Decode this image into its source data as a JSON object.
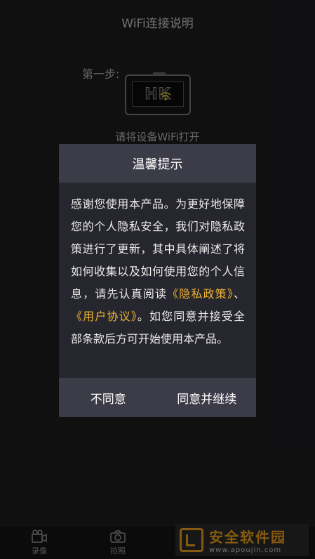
{
  "header": {
    "title": "WiFi连接说明"
  },
  "guide": {
    "step_label": "第一步:",
    "device_logo": "HK",
    "instruction": "请将设备WiFi打开"
  },
  "bottom_nav": {
    "items": [
      {
        "label": "录像",
        "icon": "video-camera-icon"
      },
      {
        "label": "拍照",
        "icon": "photo-camera-icon"
      }
    ]
  },
  "watermark": {
    "title": "安全软件园",
    "url": "www.apoujin.com"
  },
  "dialog": {
    "title": "温馨提示",
    "body_before": "感谢您使用本产品。为更好地保障您的个人隐私安全，我们对隐私政策进行了更新，其中具体阐述了将如何收集以及如何使用您的个人信息，请先认真阅读",
    "privacy_link": "《隐私政策》",
    "separator": "、",
    "terms_link": "《用户协议》",
    "body_after": "。如您同意并接受全部条款后方可开始使用本产品。",
    "disagree_label": "不同意",
    "agree_label": "同意并继续"
  },
  "colors": {
    "link": "#f0b330",
    "dialog_header": "#3c3b48",
    "dialog_body": "#26262e",
    "background": "#1e1e20"
  }
}
